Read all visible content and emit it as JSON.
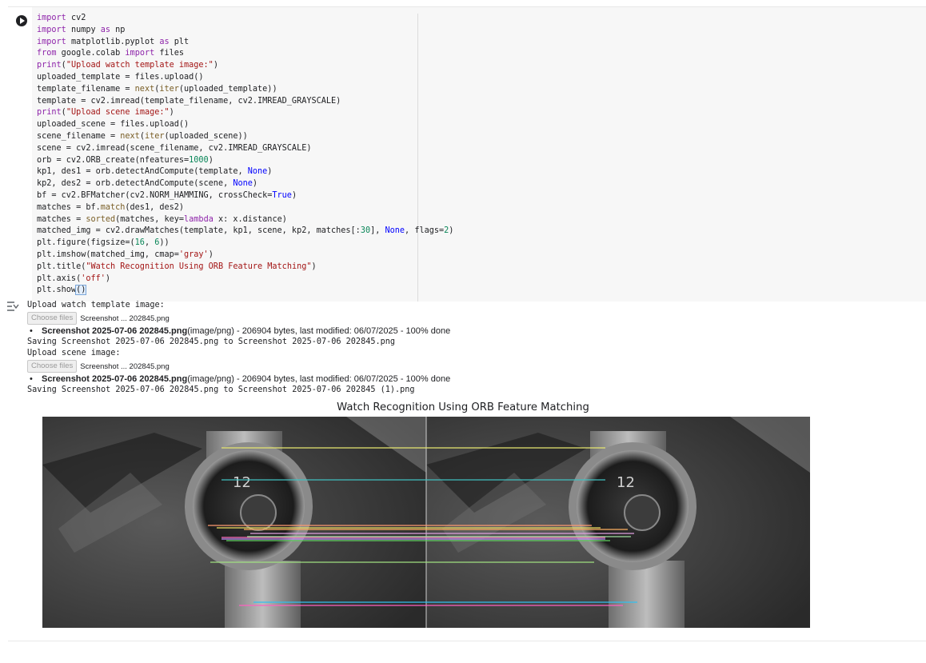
{
  "code_cell": {
    "lines": [
      [
        [
          "kw",
          "import"
        ],
        [
          "t",
          " cv2"
        ]
      ],
      [
        [
          "kw",
          "import"
        ],
        [
          "t",
          " numpy "
        ],
        [
          "kw",
          "as"
        ],
        [
          "t",
          " np"
        ]
      ],
      [
        [
          "kw",
          "import"
        ],
        [
          "t",
          " matplotlib.pyplot "
        ],
        [
          "kw",
          "as"
        ],
        [
          "t",
          " plt"
        ]
      ],
      [
        [
          "kw",
          "from"
        ],
        [
          "t",
          " google.colab "
        ],
        [
          "kw",
          "import"
        ],
        [
          "t",
          " files"
        ]
      ],
      [
        [
          "kw",
          "print"
        ],
        [
          "t",
          "("
        ],
        [
          "str",
          "\"Upload watch template image:\""
        ],
        [
          "t",
          ")"
        ]
      ],
      [
        [
          "t",
          "uploaded_template = files.upload()"
        ]
      ],
      [
        [
          "t",
          "template_filename = "
        ],
        [
          "fn",
          "next"
        ],
        [
          "t",
          "("
        ],
        [
          "fn",
          "iter"
        ],
        [
          "t",
          "(uploaded_template))"
        ]
      ],
      [
        [
          "t",
          "template = cv2.imread(template_filename, cv2.IMREAD_GRAYSCALE)"
        ]
      ],
      [
        [
          "kw",
          "print"
        ],
        [
          "t",
          "("
        ],
        [
          "str",
          "\"Upload scene image:\""
        ],
        [
          "t",
          ")"
        ]
      ],
      [
        [
          "t",
          "uploaded_scene = files.upload()"
        ]
      ],
      [
        [
          "t",
          "scene_filename = "
        ],
        [
          "fn",
          "next"
        ],
        [
          "t",
          "("
        ],
        [
          "fn",
          "iter"
        ],
        [
          "t",
          "(uploaded_scene))"
        ]
      ],
      [
        [
          "t",
          "scene = cv2.imread(scene_filename, cv2.IMREAD_GRAYSCALE)"
        ]
      ],
      [
        [
          "t",
          "orb = cv2.ORB_create(nfeatures="
        ],
        [
          "num",
          "1000"
        ],
        [
          "t",
          ")"
        ]
      ],
      [
        [
          "t",
          "kp1, des1 = orb.detectAndCompute(template, "
        ],
        [
          "cst",
          "None"
        ],
        [
          "t",
          ")"
        ]
      ],
      [
        [
          "t",
          "kp2, des2 = orb.detectAndCompute(scene, "
        ],
        [
          "cst",
          "None"
        ],
        [
          "t",
          ")"
        ]
      ],
      [
        [
          "t",
          "bf = cv2.BFMatcher(cv2.NORM_HAMMING, crossCheck="
        ],
        [
          "cst",
          "True"
        ],
        [
          "t",
          ")"
        ]
      ],
      [
        [
          "t",
          "matches = bf."
        ],
        [
          "fn",
          "match"
        ],
        [
          "t",
          "(des1, des2)"
        ]
      ],
      [
        [
          "t",
          "matches = "
        ],
        [
          "fn",
          "sorted"
        ],
        [
          "t",
          "(matches, key="
        ],
        [
          "kw",
          "lambda"
        ],
        [
          "t",
          " x: x.distance)"
        ]
      ],
      [
        [
          "t",
          "matched_img = cv2.drawMatches(template, kp1, scene, kp2, matches[:"
        ],
        [
          "num",
          "30"
        ],
        [
          "t",
          "], "
        ],
        [
          "cst",
          "None"
        ],
        [
          "t",
          ", flags="
        ],
        [
          "num",
          "2"
        ],
        [
          "t",
          ")"
        ]
      ],
      [
        [
          "t",
          "plt.figure(figsize=("
        ],
        [
          "num",
          "16"
        ],
        [
          "t",
          ", "
        ],
        [
          "num",
          "6"
        ],
        [
          "t",
          "))"
        ]
      ],
      [
        [
          "t",
          "plt.imshow(matched_img, cmap="
        ],
        [
          "str",
          "'gray'"
        ],
        [
          "t",
          ")"
        ]
      ],
      [
        [
          "t",
          "plt.title("
        ],
        [
          "str",
          "\"Watch Recognition Using ORB Feature Matching\""
        ],
        [
          "t",
          ")"
        ]
      ],
      [
        [
          "t",
          "plt.axis("
        ],
        [
          "str",
          "'off'"
        ],
        [
          "t",
          ")"
        ]
      ],
      [
        [
          "t",
          "plt.show"
        ],
        [
          "cursor",
          "()"
        ]
      ]
    ]
  },
  "output": {
    "prompt1": "Upload watch template image:",
    "choose_label": "Choose files",
    "file1_short": "Screenshot ... 202845.png",
    "upload1_name": "Screenshot 2025-07-06 202845.png",
    "upload1_meta": "(image/png) - 206904 bytes, last modified: 06/07/2025 - 100% done",
    "saving1": "Saving Screenshot 2025-07-06 202845.png to Screenshot 2025-07-06 202845.png",
    "prompt2": "Upload scene image:",
    "file2_short": "Screenshot ... 202845.png",
    "upload2_name": "Screenshot 2025-07-06 202845.png",
    "upload2_meta": "(image/png) - 206904 bytes, last modified: 06/07/2025 - 100% done",
    "saving2": "Saving Screenshot 2025-07-06 202845.png to Screenshot 2025-07-06 202845 (1).png",
    "figure_title": "Watch Recognition Using ORB Feature Matching"
  },
  "icons": {
    "run": "play-circle-icon",
    "output_toggle": "output-collapse-icon"
  },
  "colors": {
    "keyword": "#8e24aa",
    "string": "#a31515",
    "number": "#098658",
    "constant": "#0000ff",
    "function": "#795e26"
  }
}
